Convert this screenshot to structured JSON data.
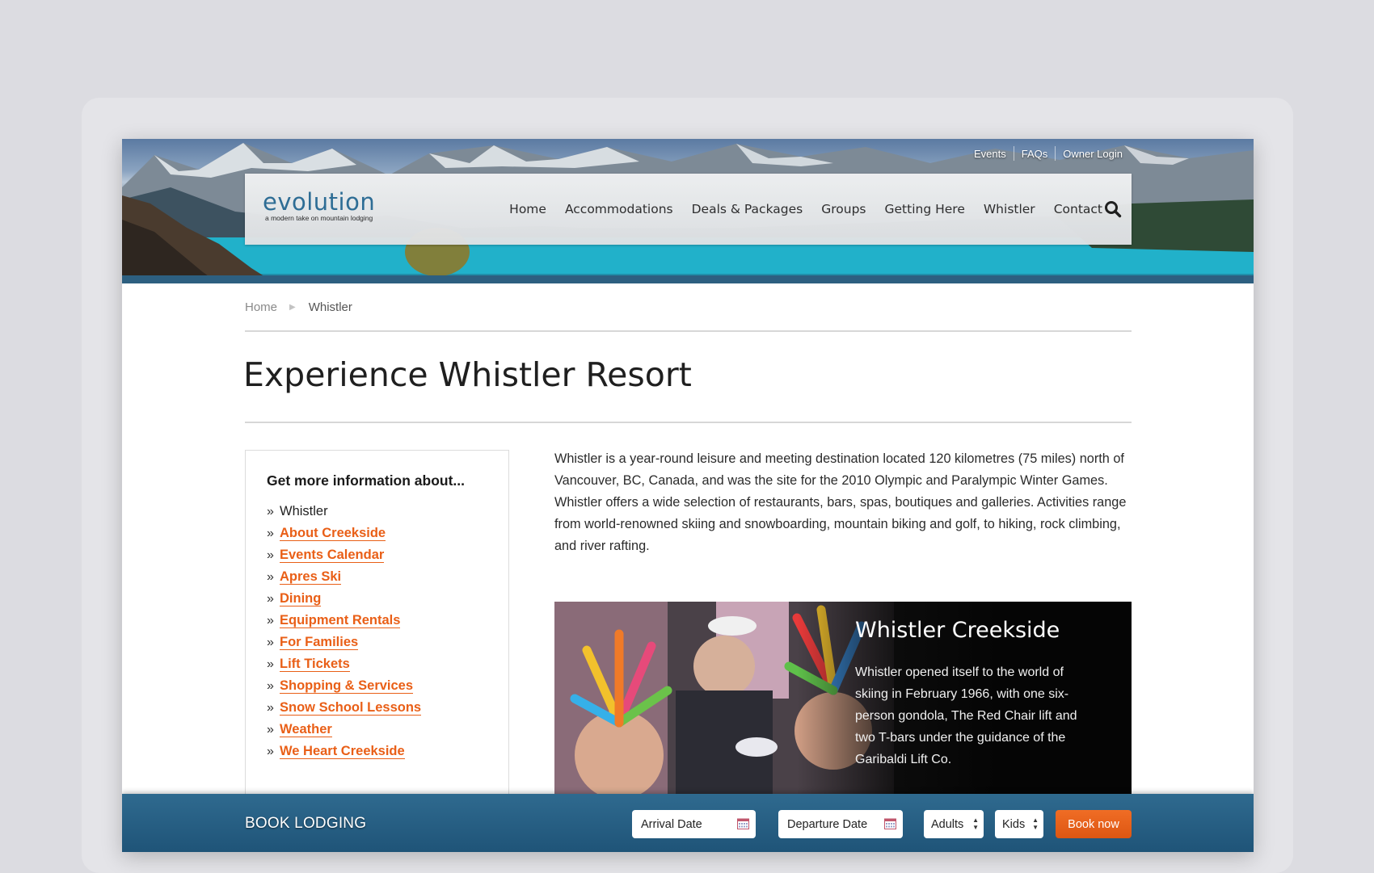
{
  "top_links": [
    "Events",
    "FAQs",
    "Owner Login"
  ],
  "logo": {
    "name": "evolution",
    "tagline": "a modern take on mountain lodging"
  },
  "nav": [
    "Home",
    "Accommodations",
    "Deals & Packages",
    "Groups",
    "Getting Here",
    "Whistler",
    "Contact"
  ],
  "breadcrumb": {
    "home": "Home",
    "current": "Whistler"
  },
  "page_title": "Experience Whistler Resort",
  "sidebar": {
    "heading": "Get more information about...",
    "current": "Whistler",
    "links": [
      "About Creekside",
      "Events Calendar",
      "Apres Ski",
      "Dining",
      "Equipment Rentals",
      "For Families",
      "Lift Tickets",
      "Shopping & Services",
      "Snow School Lessons",
      "Weather",
      "We Heart Creekside"
    ]
  },
  "intro": "Whistler is a year-round leisure and meeting destination located 120 kilometres (75 miles) north of Vancouver, BC, Canada, and was the site for the 2010 Olympic and Paralympic Winter Games. Whistler offers a wide selection of restaurants, bars, spas, boutiques and galleries. Activities range from world-renowned skiing and snowboarding, mountain biking and golf, to hiking, rock climbing, and river rafting.",
  "feature": {
    "title": "Whistler Creekside",
    "body": "Whistler opened itself to the world of skiing in February 1966, with one six-person gondola, The Red Chair lift and two T-bars under the guidance of the Garibaldi Lift Co."
  },
  "booking": {
    "label": "BOOK LODGING",
    "arrival_placeholder": "Arrival Date",
    "departure_placeholder": "Departure Date",
    "adults": "Adults",
    "kids": "Kids",
    "book_button": "Book now"
  },
  "colors": {
    "accent": "#e95f17",
    "brand": "#2b6c95",
    "booking_bar": "#245d82"
  }
}
